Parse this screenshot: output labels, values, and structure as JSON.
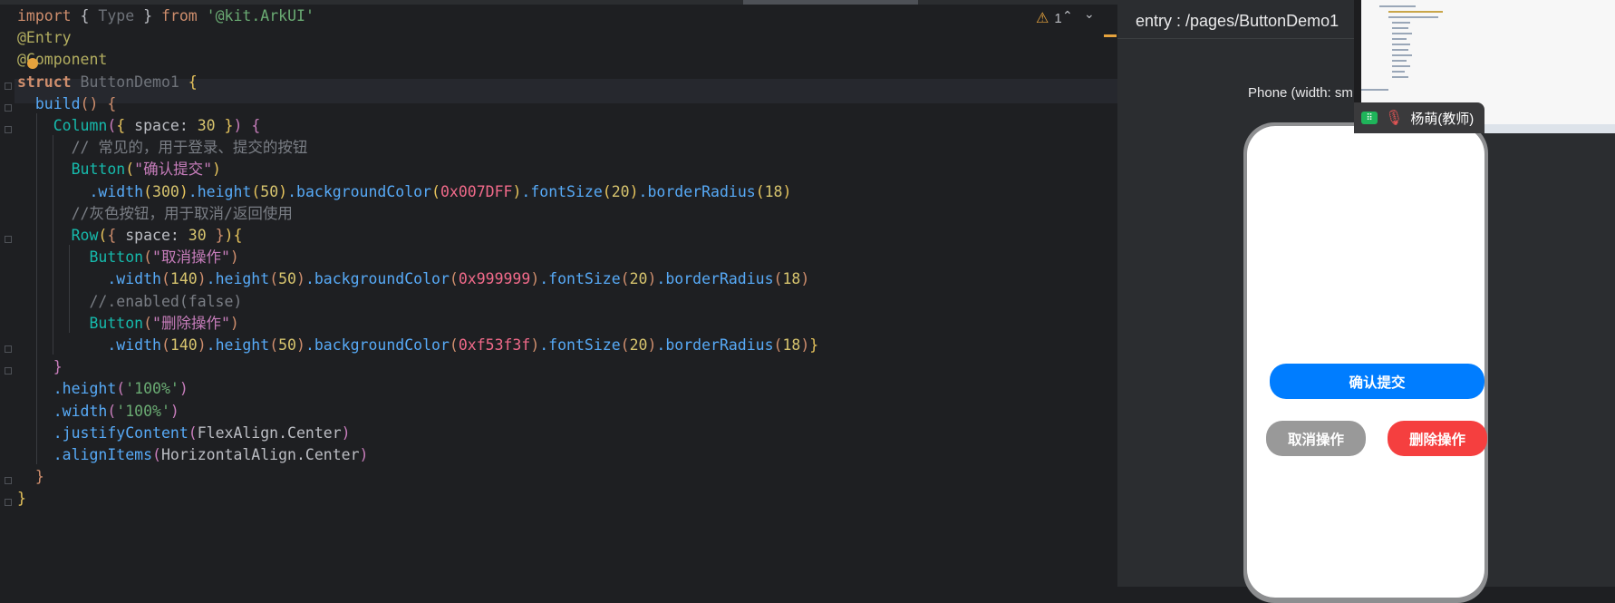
{
  "editor": {
    "inspection": {
      "warning_count": "1"
    },
    "lines": [
      {
        "parts": [
          [
            "kw",
            "import"
          ],
          [
            "",
            " { "
          ],
          [
            "ty",
            "Type"
          ],
          [
            "",
            " } "
          ],
          [
            "kw",
            "from"
          ],
          [
            "",
            " "
          ],
          [
            "sg",
            "'@kit.ArkUI'"
          ]
        ]
      },
      {
        "parts": [
          [
            "d",
            "@Entry"
          ]
        ]
      },
      {
        "parts": [
          [
            "d",
            "@Component"
          ]
        ]
      },
      {
        "parts": [
          [
            "k",
            "struct"
          ],
          [
            "",
            " "
          ],
          [
            "ty",
            "ButtonDemo1"
          ],
          [
            "",
            " "
          ],
          [
            "br1",
            "{"
          ]
        ]
      },
      {
        "parts": [
          [
            "",
            "  "
          ],
          [
            "fn",
            "build"
          ],
          [
            "br2",
            "()"
          ],
          [
            "",
            " "
          ],
          [
            "br2",
            "{"
          ]
        ]
      },
      {
        "parts": [
          [
            "",
            "    "
          ],
          [
            "t",
            "Column"
          ],
          [
            "br3",
            "("
          ],
          [
            "br1",
            "{"
          ],
          [
            "",
            " space: "
          ],
          [
            "n",
            "30"
          ],
          [
            "",
            " "
          ],
          [
            "br1",
            "}"
          ],
          [
            "br3",
            ")"
          ],
          [
            "",
            " "
          ],
          [
            "br3",
            "{"
          ]
        ]
      },
      {
        "parts": [
          [
            "",
            "      "
          ],
          [
            "c",
            "// 常见的，用于登录、提交的按钮"
          ]
        ]
      },
      {
        "parts": [
          [
            "",
            "      "
          ],
          [
            "t",
            "Button"
          ],
          [
            "br1",
            "("
          ],
          [
            "s",
            "\"确认提交\""
          ],
          [
            "br1",
            ")"
          ]
        ]
      },
      {
        "parts": [
          [
            "",
            "        "
          ],
          [
            "m",
            ".width"
          ],
          [
            "br1",
            "("
          ],
          [
            "n",
            "300"
          ],
          [
            "br1",
            ")"
          ],
          [
            "m",
            ".height"
          ],
          [
            "br1",
            "("
          ],
          [
            "n",
            "50"
          ],
          [
            "br1",
            ")"
          ],
          [
            "m",
            ".backgroundColor"
          ],
          [
            "br1",
            "("
          ],
          [
            "hx",
            "0x007DFF"
          ],
          [
            "br1",
            ")"
          ],
          [
            "m",
            ".fontSize"
          ],
          [
            "br1",
            "("
          ],
          [
            "n",
            "20"
          ],
          [
            "br1",
            ")"
          ],
          [
            "m",
            ".borderRadius"
          ],
          [
            "br1",
            "("
          ],
          [
            "n",
            "18"
          ],
          [
            "br1",
            ")"
          ]
        ]
      },
      {
        "parts": [
          [
            "",
            "      "
          ],
          [
            "c",
            "//灰色按钮，用于取消/返回使用"
          ]
        ]
      },
      {
        "parts": [
          [
            "",
            "      "
          ],
          [
            "t",
            "Row"
          ],
          [
            "br1",
            "("
          ],
          [
            "br2",
            "{"
          ],
          [
            "",
            " space: "
          ],
          [
            "n",
            "30"
          ],
          [
            "",
            " "
          ],
          [
            "br2",
            "}"
          ],
          [
            "br1",
            ")"
          ],
          [
            "br1",
            "{"
          ]
        ]
      },
      {
        "parts": [
          [
            "",
            "        "
          ],
          [
            "t",
            "Button"
          ],
          [
            "br2",
            "("
          ],
          [
            "s",
            "\"取消操作\""
          ],
          [
            "br2",
            ")"
          ]
        ]
      },
      {
        "parts": [
          [
            "",
            "          "
          ],
          [
            "m",
            ".width"
          ],
          [
            "br2",
            "("
          ],
          [
            "n",
            "140"
          ],
          [
            "br2",
            ")"
          ],
          [
            "m",
            ".height"
          ],
          [
            "br2",
            "("
          ],
          [
            "n",
            "50"
          ],
          [
            "br2",
            ")"
          ],
          [
            "m",
            ".backgroundColor"
          ],
          [
            "br2",
            "("
          ],
          [
            "hx",
            "0x999999"
          ],
          [
            "br2",
            ")"
          ],
          [
            "m",
            ".fontSize"
          ],
          [
            "br2",
            "("
          ],
          [
            "n",
            "20"
          ],
          [
            "br2",
            ")"
          ],
          [
            "m",
            ".borderRadius"
          ],
          [
            "br2",
            "("
          ],
          [
            "n",
            "18"
          ],
          [
            "br2",
            ")"
          ]
        ]
      },
      {
        "parts": [
          [
            "",
            "        "
          ],
          [
            "c",
            "//.enabled(false)"
          ]
        ]
      },
      {
        "parts": [
          [
            "",
            "        "
          ],
          [
            "t",
            "Button"
          ],
          [
            "br2",
            "("
          ],
          [
            "s",
            "\"删除操作\""
          ],
          [
            "br2",
            ")"
          ]
        ]
      },
      {
        "parts": [
          [
            "",
            "          "
          ],
          [
            "m",
            ".width"
          ],
          [
            "br2",
            "("
          ],
          [
            "n",
            "140"
          ],
          [
            "br2",
            ")"
          ],
          [
            "m",
            ".height"
          ],
          [
            "br2",
            "("
          ],
          [
            "n",
            "50"
          ],
          [
            "br2",
            ")"
          ],
          [
            "m",
            ".backgroundColor"
          ],
          [
            "br2",
            "("
          ],
          [
            "hx",
            "0xf53f3f"
          ],
          [
            "br2",
            ")"
          ],
          [
            "m",
            ".fontSize"
          ],
          [
            "br2",
            "("
          ],
          [
            "n",
            "20"
          ],
          [
            "br2",
            ")"
          ],
          [
            "m",
            ".borderRadius"
          ],
          [
            "br2",
            "("
          ],
          [
            "n",
            "18"
          ],
          [
            "br2",
            ")"
          ],
          [
            "br1",
            "}"
          ]
        ]
      },
      {
        "parts": [
          [
            "",
            "    "
          ],
          [
            "br3",
            "}"
          ]
        ]
      },
      {
        "parts": [
          [
            "",
            "    "
          ],
          [
            "m",
            ".height"
          ],
          [
            "br3",
            "("
          ],
          [
            "sg",
            "'100%'"
          ],
          [
            "br3",
            ")"
          ]
        ]
      },
      {
        "parts": [
          [
            "",
            "    "
          ],
          [
            "m",
            ".width"
          ],
          [
            "br3",
            "("
          ],
          [
            "sg",
            "'100%'"
          ],
          [
            "br3",
            ")"
          ]
        ]
      },
      {
        "parts": [
          [
            "",
            "    "
          ],
          [
            "m",
            ".justifyContent"
          ],
          [
            "br3",
            "("
          ],
          [
            "",
            "FlexAlign.Center"
          ],
          [
            "br3",
            ")"
          ]
        ]
      },
      {
        "parts": [
          [
            "",
            "    "
          ],
          [
            "m",
            ".alignItems"
          ],
          [
            "br3",
            "("
          ],
          [
            "",
            "HorizontalAlign.Center"
          ],
          [
            "br3",
            ")"
          ]
        ]
      },
      {
        "parts": [
          [
            "",
            "  "
          ],
          [
            "br2",
            "}"
          ]
        ]
      },
      {
        "parts": [
          [
            "br1",
            "}"
          ]
        ]
      }
    ]
  },
  "preview": {
    "title": "entry : /pages/ButtonDemo1",
    "device_label": "Phone (width: sm",
    "buttons": {
      "confirm": {
        "label": "确认提交",
        "color": "#007DFF"
      },
      "cancel": {
        "label": "取消操作",
        "color": "#999999"
      },
      "delete": {
        "label": "删除操作",
        "color": "#F53F3F"
      }
    }
  },
  "video": {
    "participant_name": "杨萌(教师)"
  }
}
